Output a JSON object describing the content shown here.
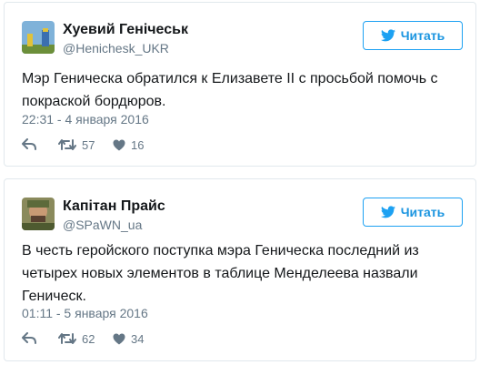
{
  "follow_label": "Читать",
  "tweets": [
    {
      "author_name": "Хуевий Генічеськ",
      "author_handle": "@Henichesk_UKR",
      "text": "Мэр Геническа  обратился к Елизавете II с просьбой помочь с покраской бордюров.",
      "timestamp": "22:31 - 4 января 2016",
      "retweets": "57",
      "likes": "16"
    },
    {
      "author_name": "Капітан Прайс",
      "author_handle": "@SPaWN_ua",
      "text": "В честь геройского поступка мэра Геническа последний из четырех новых элементов в таблице Менделеева назвали Геническ.",
      "timestamp": "01:11 - 5 января 2016",
      "retweets": "62",
      "likes": "34"
    }
  ],
  "colors": {
    "accent": "#1da1f2",
    "text_primary": "#14171a",
    "text_secondary": "#657786",
    "border": "#e1e8ed"
  },
  "icons": {
    "follow": "twitter-bird-icon",
    "reply": "reply-icon",
    "retweet": "retweet-icon",
    "like": "heart-icon"
  }
}
